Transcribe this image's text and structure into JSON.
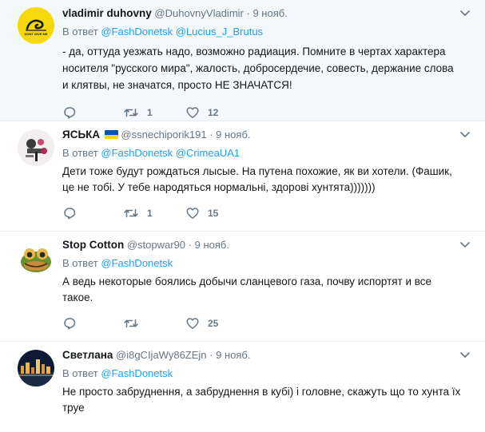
{
  "tweets": [
    {
      "fullname": "vladimir duhovny",
      "handle": "@DuhovnyVladimir",
      "dot": "·",
      "time": "9 нояб.",
      "reply_prefix": "В ответ",
      "reply_to": [
        "@FashDonetsk",
        "@Lucius_J_Brutus"
      ],
      "avatar_text": "DONT GIVE ME",
      "text": "- да, оттуда уезжать надо, возможно радиация. Помните в чертах характера носителя \"русского мира\", жалость, добросердечие, совесть, держание слова и клятвы, не значатся, просто НЕ ЗНАЧАТСЯ!",
      "replies": "",
      "retweets": "1",
      "likes": "12"
    },
    {
      "fullname": "ЯСЬКА",
      "handle": "@ssnechiporik191",
      "dot": "·",
      "time": "9 нояб.",
      "reply_prefix": "В ответ",
      "reply_to": [
        "@FashDonetsk",
        "@CrimeaUA1"
      ],
      "text": "Дети тоже будут рождаться лысые. На путена похожие, як ви хотели. (Фашик, це не тобі. У тебе народяться нормальні, здорові хунтята)))))))",
      "replies": "",
      "retweets": "1",
      "likes": "15"
    },
    {
      "fullname": "Stop Cotton",
      "handle": "@stopwar90",
      "dot": "·",
      "time": "9 нояб.",
      "reply_prefix": "В ответ",
      "reply_to": [
        "@FashDonetsk"
      ],
      "text": "А ведь некоторые боялись добычи сланцевого газа, почву испортят и все такое.",
      "replies": "",
      "retweets": "",
      "likes": "25"
    },
    {
      "fullname": "Светлана",
      "handle": "@i8gCIjaWy86ZEjn",
      "dot": "·",
      "time": "9 нояб.",
      "reply_prefix": "В ответ",
      "reply_to": [
        "@FashDonetsk"
      ],
      "text": "Не просто забруднення, а забруднення в кубі) і головне, скажуть що то хунта їх труе",
      "replies": "",
      "retweets": "",
      "likes": ""
    }
  ],
  "colors": {
    "link": "#1da1f2",
    "muted": "#657786",
    "text": "#14171a",
    "highlight_bg": "#f5f8fa"
  },
  "icons": {
    "reply": "reply-icon",
    "retweet": "retweet-icon",
    "like": "heart-icon",
    "menu": "chevron-down-icon"
  }
}
